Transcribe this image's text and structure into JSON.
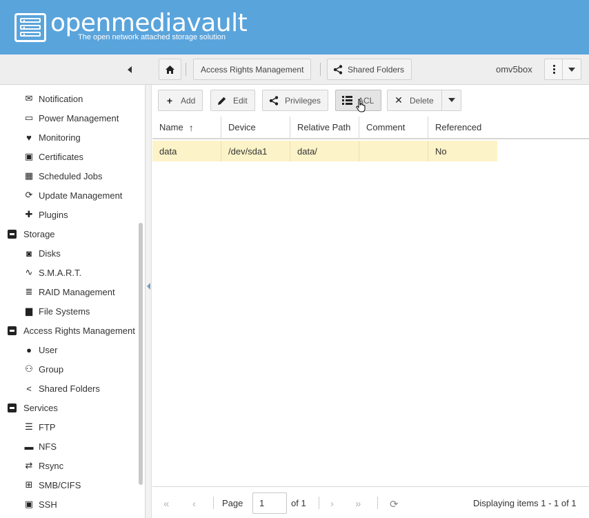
{
  "header": {
    "logo_title": "openmediavault",
    "logo_subtitle": "The open network attached storage solution",
    "brand_color": "#5aa4dc"
  },
  "breadcrumb": {
    "items": [
      "Access Rights Management",
      "Shared Folders"
    ],
    "hostname": "omv5box"
  },
  "sidebar": {
    "items": [
      {
        "label": "Notification",
        "icon": "envelope-icon"
      },
      {
        "label": "Power Management",
        "icon": "battery-icon"
      },
      {
        "label": "Monitoring",
        "icon": "heartbeat-icon"
      },
      {
        "label": "Certificates",
        "icon": "certificate-icon"
      },
      {
        "label": "Scheduled Jobs",
        "icon": "calendar-clock-icon"
      },
      {
        "label": "Update Management",
        "icon": "refresh-icon"
      },
      {
        "label": "Plugins",
        "icon": "puzzle-icon"
      },
      {
        "label": "Storage",
        "icon": "collapse-icon",
        "group": true
      },
      {
        "label": "Disks",
        "icon": "harddisk-icon"
      },
      {
        "label": "S.M.A.R.T.",
        "icon": "pulse-icon"
      },
      {
        "label": "RAID Management",
        "icon": "database-icon"
      },
      {
        "label": "File Systems",
        "icon": "folders-icon"
      },
      {
        "label": "Access Rights Management",
        "icon": "collapse-icon",
        "group": true
      },
      {
        "label": "User",
        "icon": "user-icon"
      },
      {
        "label": "Group",
        "icon": "users-icon"
      },
      {
        "label": "Shared Folders",
        "icon": "share-icon"
      },
      {
        "label": "Services",
        "icon": "collapse-icon",
        "group": true
      },
      {
        "label": "FTP",
        "icon": "server-network-icon"
      },
      {
        "label": "NFS",
        "icon": "desktop-icon"
      },
      {
        "label": "Rsync",
        "icon": "sync-icon"
      },
      {
        "label": "SMB/CIFS",
        "icon": "windows-icon"
      },
      {
        "label": "SSH",
        "icon": "console-icon"
      }
    ]
  },
  "toolbar": {
    "add": "Add",
    "edit": "Edit",
    "privileges": "Privileges",
    "acl": "ACL",
    "delete": "Delete"
  },
  "grid": {
    "columns": [
      "Name",
      "Device",
      "Relative Path",
      "Comment",
      "Referenced"
    ],
    "rows": [
      {
        "name": "data",
        "device": "/dev/sda1",
        "path": "data/",
        "comment": "",
        "referenced": "No"
      }
    ],
    "selected_row_color": "#fcf3c8"
  },
  "pager": {
    "page_label": "Page",
    "page_value": "1",
    "of_label": "of 1",
    "display": "Displaying items 1 - 1 of 1"
  }
}
